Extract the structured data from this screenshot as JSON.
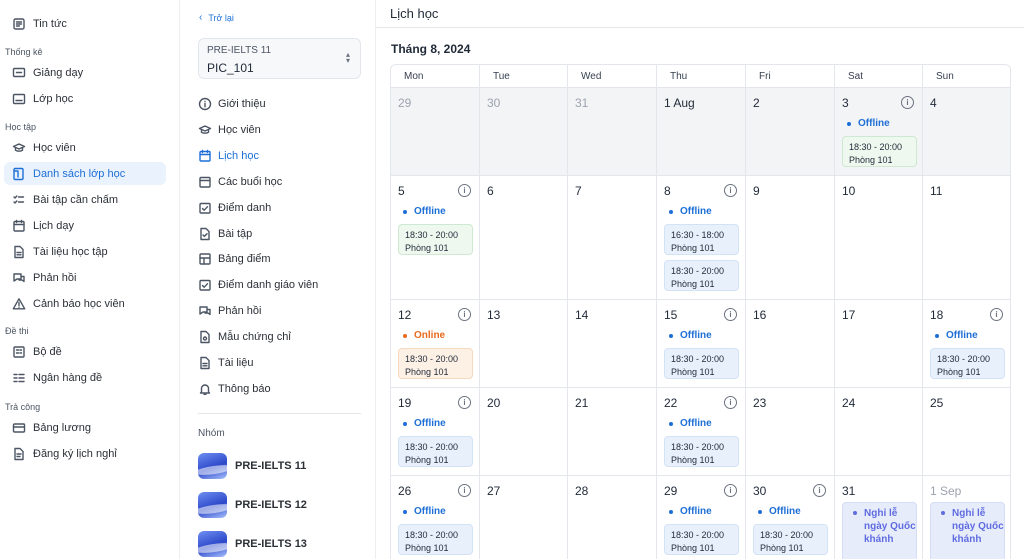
{
  "sidebar": {
    "top_item": {
      "label": "Tin tức",
      "icon": "news-icon"
    },
    "sections": [
      {
        "title": "Thống kê",
        "items": [
          {
            "label": "Giảng dạy",
            "icon": "teaching-icon"
          },
          {
            "label": "Lớp học",
            "icon": "classroom-icon"
          }
        ]
      },
      {
        "title": "Học tập",
        "items": [
          {
            "label": "Học viên",
            "icon": "student-cap-icon"
          },
          {
            "label": "Danh sách lớp học",
            "icon": "class-list-icon",
            "active": true
          },
          {
            "label": "Bài tập cần chấm",
            "icon": "checklist-icon"
          },
          {
            "label": "Lịch dạy",
            "icon": "calendar-icon"
          },
          {
            "label": "Tài liệu học tập",
            "icon": "document-icon"
          },
          {
            "label": "Phản hồi",
            "icon": "feedback-icon"
          },
          {
            "label": "Cảnh báo học viên",
            "icon": "warning-icon"
          }
        ]
      },
      {
        "title": "Đề thi",
        "items": [
          {
            "label": "Bộ đề",
            "icon": "exam-set-icon"
          },
          {
            "label": "Ngân hàng đề",
            "icon": "question-bank-icon"
          }
        ]
      },
      {
        "title": "Trả công",
        "items": [
          {
            "label": "Bảng lương",
            "icon": "payroll-icon"
          },
          {
            "label": "Đăng ký lịch nghỉ",
            "icon": "leave-request-icon"
          }
        ]
      }
    ]
  },
  "class_panel": {
    "back_label": "Trở lại",
    "selector": {
      "course": "PRE-IELTS 11",
      "class_code": "PIC_101"
    },
    "menu": [
      {
        "label": "Giới thiệu",
        "icon": "info-icon"
      },
      {
        "label": "Học viên",
        "icon": "student-cap-icon"
      },
      {
        "label": "Lịch học",
        "icon": "calendar-icon",
        "active": true
      },
      {
        "label": "Các buổi học",
        "icon": "sessions-icon"
      },
      {
        "label": "Điểm danh",
        "icon": "attendance-icon"
      },
      {
        "label": "Bài tập",
        "icon": "assignment-icon"
      },
      {
        "label": "Bảng điểm",
        "icon": "gradebook-icon"
      },
      {
        "label": "Điểm danh giáo viên",
        "icon": "attendance-icon"
      },
      {
        "label": "Phản hồi",
        "icon": "feedback-icon"
      },
      {
        "label": "Mẫu chứng chỉ",
        "icon": "certificate-icon"
      },
      {
        "label": "Tài liệu",
        "icon": "document-icon"
      },
      {
        "label": "Thông báo",
        "icon": "bell-icon"
      }
    ],
    "group_title": "Nhóm",
    "groups": [
      "PRE-IELTS 11",
      "PRE-IELTS 12",
      "PRE-IELTS 13"
    ]
  },
  "calendar": {
    "page_title": "Lịch học",
    "month_label": "Tháng 8, 2024",
    "weekdays": [
      "Mon",
      "Tue",
      "Wed",
      "Thu",
      "Fri",
      "Sat",
      "Sun"
    ],
    "room": "Phòng 101",
    "weeks": [
      [
        {
          "day": "29",
          "other": true,
          "shaded": true
        },
        {
          "day": "30",
          "other": true,
          "shaded": true
        },
        {
          "day": "31",
          "other": true,
          "shaded": true
        },
        {
          "day": "1 Aug",
          "shaded": true
        },
        {
          "day": "2",
          "shaded": true
        },
        {
          "day": "3",
          "shaded": true,
          "info": true,
          "mode": "Offline",
          "slots": [
            {
              "time": "18:30 - 20:00",
              "room": "Phòng 101",
              "tone": "green"
            }
          ]
        },
        {
          "day": "4",
          "shaded": true
        }
      ],
      [
        {
          "day": "5",
          "info": true,
          "mode": "Offline",
          "slots": [
            {
              "time": "18:30 - 20:00",
              "room": "Phòng 101",
              "tone": "green"
            }
          ]
        },
        {
          "day": "6"
        },
        {
          "day": "7"
        },
        {
          "day": "8",
          "info": true,
          "mode": "Offline",
          "slots": [
            {
              "time": "16:30 - 18:00",
              "room": "Phòng 101",
              "tone": "blue"
            },
            {
              "time": "18:30 - 20:00",
              "room": "Phòng 101",
              "tone": "blue"
            }
          ]
        },
        {
          "day": "9"
        },
        {
          "day": "10"
        },
        {
          "day": "11"
        }
      ],
      [
        {
          "day": "12",
          "info": true,
          "mode": "Online",
          "slots": [
            {
              "time": "18:30 - 20:00",
              "room": "Phòng 101",
              "tone": "orange"
            }
          ]
        },
        {
          "day": "13"
        },
        {
          "day": "14"
        },
        {
          "day": "15",
          "info": true,
          "mode": "Offline",
          "slots": [
            {
              "time": "18:30 - 20:00",
              "room": "Phòng 101",
              "tone": "blue"
            }
          ]
        },
        {
          "day": "16"
        },
        {
          "day": "17"
        },
        {
          "day": "18",
          "info": true,
          "mode": "Offline",
          "slots": [
            {
              "time": "18:30 - 20:00",
              "room": "Phòng 101",
              "tone": "blue"
            }
          ]
        }
      ],
      [
        {
          "day": "19",
          "info": true,
          "mode": "Offline",
          "slots": [
            {
              "time": "18:30 - 20:00",
              "room": "Phòng 101",
              "tone": "blue"
            }
          ]
        },
        {
          "day": "20"
        },
        {
          "day": "21"
        },
        {
          "day": "22",
          "info": true,
          "mode": "Offline",
          "slots": [
            {
              "time": "18:30 - 20:00",
              "room": "Phòng 101",
              "tone": "blue"
            }
          ]
        },
        {
          "day": "23"
        },
        {
          "day": "24"
        },
        {
          "day": "25"
        }
      ],
      [
        {
          "day": "26",
          "info": true,
          "mode": "Offline",
          "slots": [
            {
              "time": "18:30 - 20:00",
              "room": "Phòng 101",
              "tone": "blue"
            }
          ]
        },
        {
          "day": "27"
        },
        {
          "day": "28"
        },
        {
          "day": "29",
          "info": true,
          "mode": "Offline",
          "slots": [
            {
              "time": "18:30 - 20:00",
              "room": "Phòng 101",
              "tone": "blue"
            }
          ]
        },
        {
          "day": "30",
          "info": true,
          "mode": "Offline",
          "slots": [
            {
              "time": "18:30 - 20:00",
              "room": "Phòng 101",
              "tone": "blue"
            }
          ]
        },
        {
          "day": "31",
          "holiday": "Nghỉ lễ ngày Quốc khánh"
        },
        {
          "day": "1 Sep",
          "other": true,
          "holiday": "Nghỉ lễ ngày Quốc khánh"
        }
      ]
    ]
  }
}
